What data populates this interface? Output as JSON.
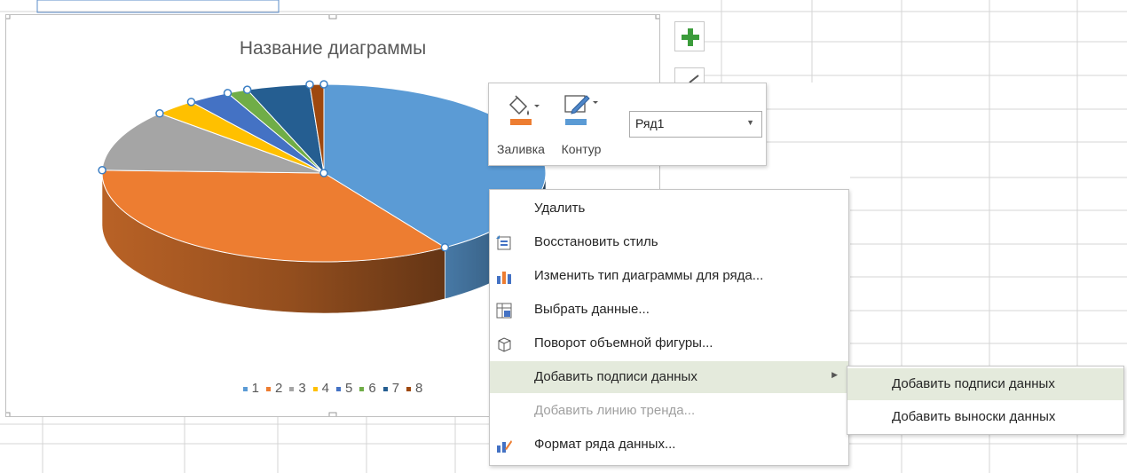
{
  "chart": {
    "title": "Название диаграммы",
    "legend": [
      {
        "label": "1",
        "color": "#5b9bd5"
      },
      {
        "label": "2",
        "color": "#ed7d31"
      },
      {
        "label": "3",
        "color": "#a5a5a5"
      },
      {
        "label": "4",
        "color": "#ffc000"
      },
      {
        "label": "5",
        "color": "#4472c4"
      },
      {
        "label": "6",
        "color": "#70ad47"
      },
      {
        "label": "7",
        "color": "#255e91"
      },
      {
        "label": "8",
        "color": "#9e480e"
      }
    ]
  },
  "chart_data": {
    "type": "pie",
    "title": "Название диаграммы",
    "categories": [
      "1",
      "2",
      "3",
      "4",
      "5",
      "6",
      "7",
      "8"
    ],
    "values": [
      40,
      34,
      11,
      3,
      3,
      1.5,
      4.5,
      1
    ],
    "legend_position": "bottom",
    "style": "3d"
  },
  "side_buttons": [
    {
      "icon": "plus-icon"
    },
    {
      "icon": "brush-icon"
    }
  ],
  "mini_toolbar": {
    "fill_label": "Заливка",
    "outline_label": "Контур",
    "series_value": "Ряд1",
    "fill_color": "#ed7d31",
    "outline_color": "#5b9bd5"
  },
  "context_menu": {
    "items": [
      {
        "label": "Удалить",
        "icon": "",
        "disabled": false
      },
      {
        "label": "Восстановить стиль",
        "icon": "reset-style-icon",
        "disabled": false
      },
      {
        "label": "Изменить тип диаграммы для ряда...",
        "icon": "chart-type-icon",
        "disabled": false
      },
      {
        "label": "Выбрать данные...",
        "icon": "select-data-icon",
        "disabled": false
      },
      {
        "label": "Поворот объемной фигуры...",
        "icon": "3d-rotation-icon",
        "disabled": false
      },
      {
        "label": "Добавить подписи данных",
        "icon": "",
        "disabled": false,
        "submenu": true
      },
      {
        "label": "Добавить линию тренда...",
        "icon": "",
        "disabled": true
      },
      {
        "label": "Формат ряда данных...",
        "icon": "format-series-icon",
        "disabled": false
      }
    ]
  },
  "submenu": {
    "items": [
      {
        "label": "Добавить подписи данных"
      },
      {
        "label": "Добавить выноски данных"
      }
    ]
  }
}
